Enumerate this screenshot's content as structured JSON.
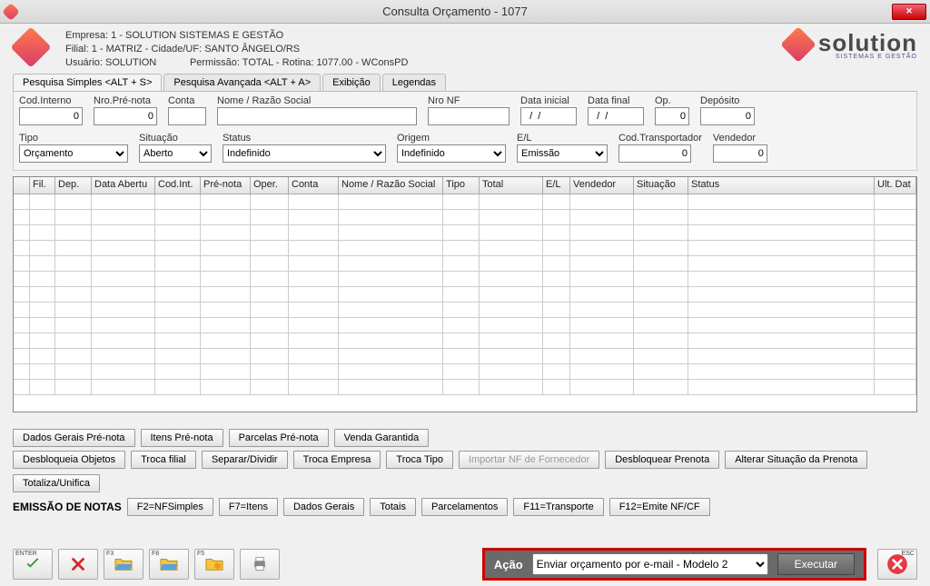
{
  "window": {
    "title": "Consulta Orçamento - 1077"
  },
  "header": {
    "line1": "Empresa: 1 - SOLUTION SISTEMAS E GESTÃO",
    "line2": "Filial: 1 - MATRIZ - Cidade/UF: SANTO ÂNGELO/RS",
    "line3_left": "Usuário: SOLUTION",
    "line3_right": "Permissão: TOTAL - Rotina: 1077.00 - WConsPD",
    "brand_word": "solution",
    "brand_sub": "SISTEMAS E GESTÃO"
  },
  "tabs": {
    "t0": "Pesquisa Simples <ALT + S>",
    "t1": "Pesquisa Avançada <ALT + A>",
    "t2": "Exibição",
    "t3": "Legendas"
  },
  "filters": {
    "cod_interno": {
      "label": "Cod.Interno",
      "value": "0"
    },
    "nro_prenota": {
      "label": "Nro.Pré-nota",
      "value": "0"
    },
    "conta": {
      "label": "Conta",
      "value": ""
    },
    "razao": {
      "label": "Nome / Razão Social",
      "value": ""
    },
    "nro_nf": {
      "label": "Nro NF",
      "value": ""
    },
    "data_inicial": {
      "label": "Data inicial",
      "value": "  /  /"
    },
    "data_final": {
      "label": "Data final",
      "value": "  /  /"
    },
    "op": {
      "label": "Op.",
      "value": "0"
    },
    "deposito": {
      "label": "Depósito",
      "value": "0"
    },
    "tipo": {
      "label": "Tipo",
      "value": "Orçamento"
    },
    "situacao": {
      "label": "Situação",
      "value": "Aberto"
    },
    "status": {
      "label": "Status",
      "value": "Indefinido"
    },
    "origem": {
      "label": "Origem",
      "value": "Indefinido"
    },
    "el": {
      "label": "E/L",
      "value": "Emissão"
    },
    "cod_transport": {
      "label": "Cod.Transportador",
      "value": "0"
    },
    "vendedor": {
      "label": "Vendedor",
      "value": "0"
    }
  },
  "grid": {
    "cols": {
      "c0": "",
      "c1": "Fil.",
      "c2": "Dep.",
      "c3": "Data Abertu",
      "c4": "Cod.Int.",
      "c5": "Pré-nota",
      "c6": "Oper.",
      "c7": "Conta",
      "c8": "Nome / Razão Social",
      "c9": "Tipo",
      "c10": "Total",
      "c11": "E/L",
      "c12": "Vendedor",
      "c13": "Situação",
      "c14": "Status",
      "c15": "Ult. Dat"
    }
  },
  "buttons_row1": {
    "b0": "Dados Gerais Pré-nota",
    "b1": "Itens Pré-nota",
    "b2": "Parcelas Pré-nota",
    "b3": "Venda Garantida"
  },
  "buttons_row2": {
    "b0": "Desbloqueia Objetos",
    "b1": "Troca filial",
    "b2": "Separar/Dividir",
    "b3": "Troca Empresa",
    "b4": "Troca Tipo",
    "b5": "Importar NF de Fornecedor",
    "b6": "Desbloquear Prenota",
    "b7": "Alterar Situação da Prenota",
    "b8": "Totaliza/Unifica"
  },
  "emissao": {
    "label": "EMISSÃO DE NOTAS",
    "b0": "F2=NFSimples",
    "b1": "F7=Itens",
    "b2": "Dados Gerais",
    "b3": "Totais",
    "b4": "Parcelamentos",
    "b5": "F11=Transporte",
    "b6": "F12=Emite NF/CF"
  },
  "bottom": {
    "enter": "ENTER",
    "f3": "F3",
    "f8": "F8",
    "f5": "F5",
    "acao_label": "Ação",
    "acao_value": "Enviar orçamento por e-mail - Modelo 2",
    "executar": "Executar",
    "esc": "ESC"
  }
}
